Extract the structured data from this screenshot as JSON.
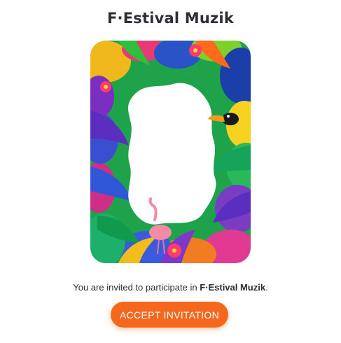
{
  "event": {
    "title": "F·Estival Muzik"
  },
  "invitation": {
    "prefix": "You are invited to participate in ",
    "event_name": "F·Estival Muzik",
    "suffix": "."
  },
  "actions": {
    "accept_label": "ACCEPT INVITATION"
  },
  "theme": {
    "accent": "#f5671d",
    "text": "#2b2d33",
    "background": "#ffffff"
  },
  "artwork": {
    "icons": [
      "tropical-leaves-frame",
      "toucan-icon",
      "flamingo-icon",
      "hibiscus-flower-icon"
    ]
  }
}
